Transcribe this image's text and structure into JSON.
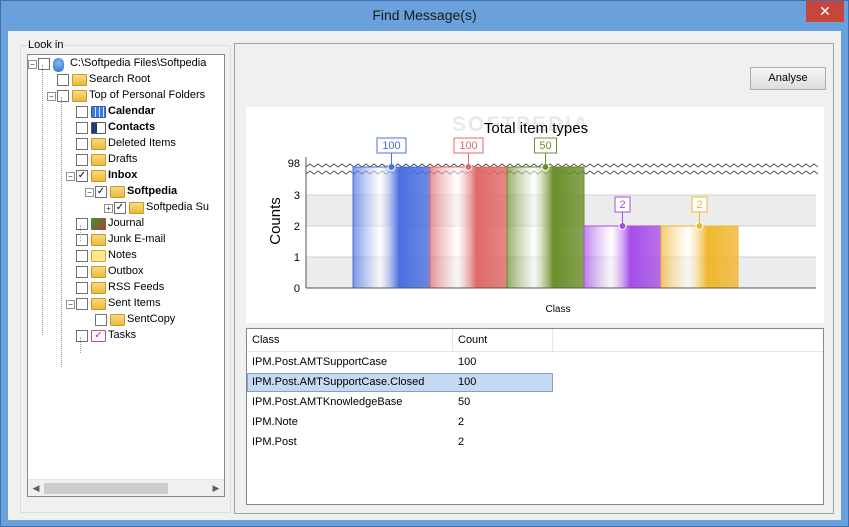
{
  "window": {
    "title": "Find Message(s)",
    "close_glyph": "✕"
  },
  "lookin": {
    "label": "Look in",
    "tree": [
      {
        "label": "C:\\Softpedia Files\\Softpedia",
        "level": 0,
        "checked": false,
        "bold": false,
        "icon": "database-icon",
        "expander": "minus"
      },
      {
        "label": "Search Root",
        "level": 1,
        "checked": false,
        "bold": false,
        "icon": "folder-icon",
        "expander": ""
      },
      {
        "label": "Top of Personal Folders",
        "level": 1,
        "checked": false,
        "bold": false,
        "icon": "folder-icon",
        "expander": "minus"
      },
      {
        "label": "Calendar",
        "level": 2,
        "checked": false,
        "bold": true,
        "icon": "calendar-icon",
        "expander": ""
      },
      {
        "label": "Contacts",
        "level": 2,
        "checked": false,
        "bold": true,
        "icon": "contacts-icon",
        "expander": ""
      },
      {
        "label": "Deleted Items",
        "level": 2,
        "checked": false,
        "bold": false,
        "icon": "folder-icon",
        "expander": ""
      },
      {
        "label": "Drafts",
        "level": 2,
        "checked": false,
        "bold": false,
        "icon": "folder-icon",
        "expander": ""
      },
      {
        "label": "Inbox",
        "level": 2,
        "checked": true,
        "bold": true,
        "icon": "folder-icon",
        "expander": "minus"
      },
      {
        "label": "Softpedia",
        "level": 3,
        "checked": true,
        "bold": true,
        "icon": "folder-icon",
        "expander": "minus"
      },
      {
        "label": "Softpedia Su",
        "level": 4,
        "checked": true,
        "bold": false,
        "icon": "folder-icon",
        "expander": "plus"
      },
      {
        "label": "Journal",
        "level": 2,
        "checked": false,
        "bold": false,
        "icon": "journal-icon",
        "expander": ""
      },
      {
        "label": "Junk E-mail",
        "level": 2,
        "checked": false,
        "bold": false,
        "icon": "folder-icon",
        "expander": ""
      },
      {
        "label": "Notes",
        "level": 2,
        "checked": false,
        "bold": false,
        "icon": "notes-icon",
        "expander": ""
      },
      {
        "label": "Outbox",
        "level": 2,
        "checked": false,
        "bold": false,
        "icon": "folder-icon",
        "expander": ""
      },
      {
        "label": "RSS Feeds",
        "level": 2,
        "checked": false,
        "bold": false,
        "icon": "folder-icon",
        "expander": ""
      },
      {
        "label": "Sent Items",
        "level": 2,
        "checked": false,
        "bold": false,
        "icon": "folder-icon",
        "expander": "minus"
      },
      {
        "label": "SentCopy",
        "level": 3,
        "checked": false,
        "bold": false,
        "icon": "folder-icon",
        "expander": ""
      },
      {
        "label": "Tasks",
        "level": 2,
        "checked": false,
        "bold": false,
        "icon": "tasks-icon",
        "expander": ""
      }
    ]
  },
  "toolbar": {
    "analyse_label": "Analyse"
  },
  "watermark": "SOFTPEDIA",
  "chart_data": {
    "type": "bar",
    "title": "Total item types",
    "xlabel": "Class",
    "ylabel": "Counts",
    "categories": [
      "IPM.Post.AMTSupportCase",
      "IPM.Post.AMTSupportCase.Closed",
      "IPM.Post.AMTKnowledgeBase",
      "IPM.Note",
      "IPM.Post"
    ],
    "values": [
      100,
      100,
      50,
      2,
      2
    ],
    "data_labels": [
      "100",
      "100",
      "50",
      "2",
      "2"
    ],
    "colors": [
      "#4a6fe0",
      "#e06a6a",
      "#6b8f2a",
      "#a54ee8",
      "#f0b630"
    ],
    "y_ticks": [
      "0",
      "1",
      "2",
      "3",
      "98"
    ],
    "axis_break": true,
    "legend": "none",
    "grid": true
  },
  "table": {
    "columns": [
      "Class",
      "Count"
    ],
    "rows": [
      {
        "class": "IPM.Post.AMTSupportCase",
        "count": "100",
        "selected": false
      },
      {
        "class": "IPM.Post.AMTSupportCase.Closed",
        "count": "100",
        "selected": true
      },
      {
        "class": "IPM.Post.AMTKnowledgeBase",
        "count": "50",
        "selected": false
      },
      {
        "class": "IPM.Note",
        "count": "2",
        "selected": false
      },
      {
        "class": "IPM.Post",
        "count": "2",
        "selected": false
      }
    ]
  }
}
